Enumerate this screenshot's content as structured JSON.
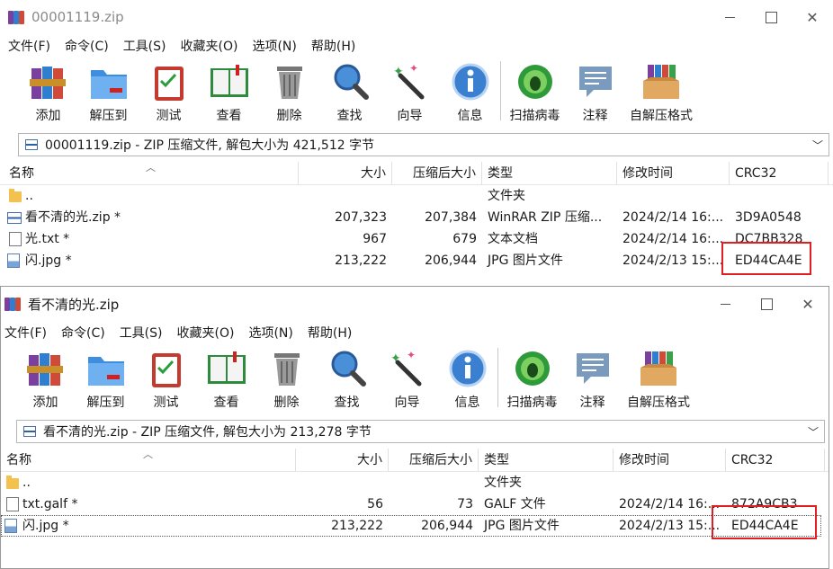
{
  "windows": [
    {
      "title": "00001119.zip",
      "menu": [
        "文件(F)",
        "命令(C)",
        "工具(S)",
        "收藏夹(O)",
        "选项(N)",
        "帮助(H)"
      ],
      "toolbar": [
        "添加",
        "解压到",
        "测试",
        "查看",
        "删除",
        "查找",
        "向导",
        "信息",
        "扫描病毒",
        "注释",
        "自解压格式"
      ],
      "address": "00001119.zip - ZIP 压缩文件, 解包大小为 421,512 字节",
      "columns": [
        "名称",
        "大小",
        "压缩后大小",
        "类型",
        "修改时间",
        "CRC32"
      ],
      "rows": [
        {
          "icon": "folder-icon",
          "name": "..",
          "size": "",
          "packed": "",
          "type": "文件夹",
          "modified": "",
          "crc": ""
        },
        {
          "icon": "zip-file-icon",
          "name": "看不清的光.zip *",
          "size": "207,323",
          "packed": "207,384",
          "type": "WinRAR ZIP 压缩...",
          "modified": "2024/2/14 16:...",
          "crc": "3D9A0548"
        },
        {
          "icon": "text-file-icon",
          "name": "光.txt *",
          "size": "967",
          "packed": "679",
          "type": "文本文档",
          "modified": "2024/2/14 16:...",
          "crc": "DC7BB328"
        },
        {
          "icon": "image-file-icon",
          "name": "闪.jpg *",
          "size": "213,222",
          "packed": "206,944",
          "type": "JPG 图片文件",
          "modified": "2024/2/13 15:...",
          "crc": "ED44CA4E"
        }
      ]
    },
    {
      "title": "看不清的光.zip",
      "menu": [
        "文件(F)",
        "命令(C)",
        "工具(S)",
        "收藏夹(O)",
        "选项(N)",
        "帮助(H)"
      ],
      "toolbar": [
        "添加",
        "解压到",
        "测试",
        "查看",
        "删除",
        "查找",
        "向导",
        "信息",
        "扫描病毒",
        "注释",
        "自解压格式"
      ],
      "address": "看不清的光.zip - ZIP 压缩文件, 解包大小为 213,278 字节",
      "columns": [
        "名称",
        "大小",
        "压缩后大小",
        "类型",
        "修改时间",
        "CRC32"
      ],
      "rows": [
        {
          "icon": "folder-icon",
          "name": "..",
          "size": "",
          "packed": "",
          "type": "文件夹",
          "modified": "",
          "crc": ""
        },
        {
          "icon": "text-file-icon",
          "name": "txt.galf *",
          "size": "56",
          "packed": "73",
          "type": "GALF 文件",
          "modified": "2024/2/14 16:...",
          "crc": "872A9CB3"
        },
        {
          "icon": "image-file-icon",
          "name": "闪.jpg *",
          "size": "213,222",
          "packed": "206,944",
          "type": "JPG 图片文件",
          "modified": "2024/2/13 15:...",
          "crc": "ED44CA4E"
        }
      ]
    }
  ],
  "colors": {
    "highlight": "#e02020",
    "folder": "#f2c14e"
  }
}
